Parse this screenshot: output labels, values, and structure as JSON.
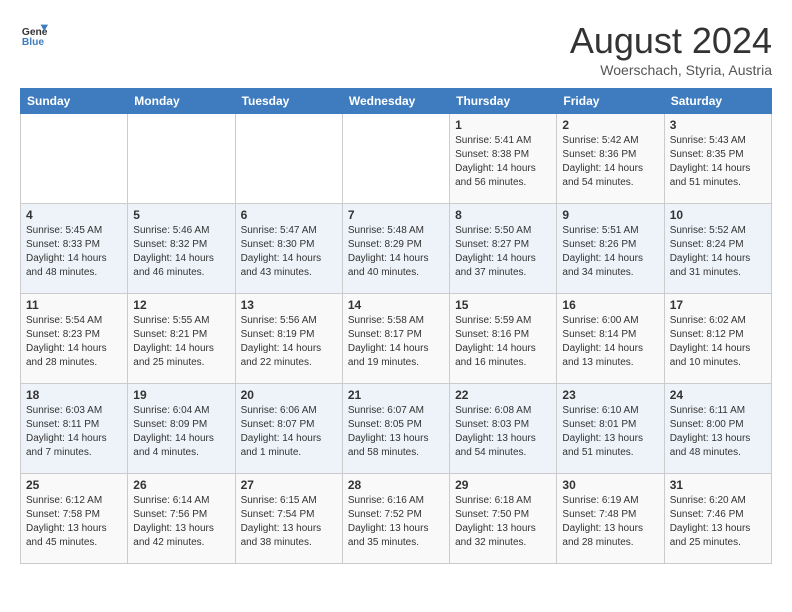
{
  "header": {
    "logo_line1": "General",
    "logo_line2": "Blue",
    "month_year": "August 2024",
    "location": "Woerschach, Styria, Austria"
  },
  "calendar": {
    "days_of_week": [
      "Sunday",
      "Monday",
      "Tuesday",
      "Wednesday",
      "Thursday",
      "Friday",
      "Saturday"
    ],
    "weeks": [
      [
        {
          "day": "",
          "info": ""
        },
        {
          "day": "",
          "info": ""
        },
        {
          "day": "",
          "info": ""
        },
        {
          "day": "",
          "info": ""
        },
        {
          "day": "1",
          "info": "Sunrise: 5:41 AM\nSunset: 8:38 PM\nDaylight: 14 hours\nand 56 minutes."
        },
        {
          "day": "2",
          "info": "Sunrise: 5:42 AM\nSunset: 8:36 PM\nDaylight: 14 hours\nand 54 minutes."
        },
        {
          "day": "3",
          "info": "Sunrise: 5:43 AM\nSunset: 8:35 PM\nDaylight: 14 hours\nand 51 minutes."
        }
      ],
      [
        {
          "day": "4",
          "info": "Sunrise: 5:45 AM\nSunset: 8:33 PM\nDaylight: 14 hours\nand 48 minutes."
        },
        {
          "day": "5",
          "info": "Sunrise: 5:46 AM\nSunset: 8:32 PM\nDaylight: 14 hours\nand 46 minutes."
        },
        {
          "day": "6",
          "info": "Sunrise: 5:47 AM\nSunset: 8:30 PM\nDaylight: 14 hours\nand 43 minutes."
        },
        {
          "day": "7",
          "info": "Sunrise: 5:48 AM\nSunset: 8:29 PM\nDaylight: 14 hours\nand 40 minutes."
        },
        {
          "day": "8",
          "info": "Sunrise: 5:50 AM\nSunset: 8:27 PM\nDaylight: 14 hours\nand 37 minutes."
        },
        {
          "day": "9",
          "info": "Sunrise: 5:51 AM\nSunset: 8:26 PM\nDaylight: 14 hours\nand 34 minutes."
        },
        {
          "day": "10",
          "info": "Sunrise: 5:52 AM\nSunset: 8:24 PM\nDaylight: 14 hours\nand 31 minutes."
        }
      ],
      [
        {
          "day": "11",
          "info": "Sunrise: 5:54 AM\nSunset: 8:23 PM\nDaylight: 14 hours\nand 28 minutes."
        },
        {
          "day": "12",
          "info": "Sunrise: 5:55 AM\nSunset: 8:21 PM\nDaylight: 14 hours\nand 25 minutes."
        },
        {
          "day": "13",
          "info": "Sunrise: 5:56 AM\nSunset: 8:19 PM\nDaylight: 14 hours\nand 22 minutes."
        },
        {
          "day": "14",
          "info": "Sunrise: 5:58 AM\nSunset: 8:17 PM\nDaylight: 14 hours\nand 19 minutes."
        },
        {
          "day": "15",
          "info": "Sunrise: 5:59 AM\nSunset: 8:16 PM\nDaylight: 14 hours\nand 16 minutes."
        },
        {
          "day": "16",
          "info": "Sunrise: 6:00 AM\nSunset: 8:14 PM\nDaylight: 14 hours\nand 13 minutes."
        },
        {
          "day": "17",
          "info": "Sunrise: 6:02 AM\nSunset: 8:12 PM\nDaylight: 14 hours\nand 10 minutes."
        }
      ],
      [
        {
          "day": "18",
          "info": "Sunrise: 6:03 AM\nSunset: 8:11 PM\nDaylight: 14 hours\nand 7 minutes."
        },
        {
          "day": "19",
          "info": "Sunrise: 6:04 AM\nSunset: 8:09 PM\nDaylight: 14 hours\nand 4 minutes."
        },
        {
          "day": "20",
          "info": "Sunrise: 6:06 AM\nSunset: 8:07 PM\nDaylight: 14 hours\nand 1 minute."
        },
        {
          "day": "21",
          "info": "Sunrise: 6:07 AM\nSunset: 8:05 PM\nDaylight: 13 hours\nand 58 minutes."
        },
        {
          "day": "22",
          "info": "Sunrise: 6:08 AM\nSunset: 8:03 PM\nDaylight: 13 hours\nand 54 minutes."
        },
        {
          "day": "23",
          "info": "Sunrise: 6:10 AM\nSunset: 8:01 PM\nDaylight: 13 hours\nand 51 minutes."
        },
        {
          "day": "24",
          "info": "Sunrise: 6:11 AM\nSunset: 8:00 PM\nDaylight: 13 hours\nand 48 minutes."
        }
      ],
      [
        {
          "day": "25",
          "info": "Sunrise: 6:12 AM\nSunset: 7:58 PM\nDaylight: 13 hours\nand 45 minutes."
        },
        {
          "day": "26",
          "info": "Sunrise: 6:14 AM\nSunset: 7:56 PM\nDaylight: 13 hours\nand 42 minutes."
        },
        {
          "day": "27",
          "info": "Sunrise: 6:15 AM\nSunset: 7:54 PM\nDaylight: 13 hours\nand 38 minutes."
        },
        {
          "day": "28",
          "info": "Sunrise: 6:16 AM\nSunset: 7:52 PM\nDaylight: 13 hours\nand 35 minutes."
        },
        {
          "day": "29",
          "info": "Sunrise: 6:18 AM\nSunset: 7:50 PM\nDaylight: 13 hours\nand 32 minutes."
        },
        {
          "day": "30",
          "info": "Sunrise: 6:19 AM\nSunset: 7:48 PM\nDaylight: 13 hours\nand 28 minutes."
        },
        {
          "day": "31",
          "info": "Sunrise: 6:20 AM\nSunset: 7:46 PM\nDaylight: 13 hours\nand 25 minutes."
        }
      ]
    ]
  }
}
